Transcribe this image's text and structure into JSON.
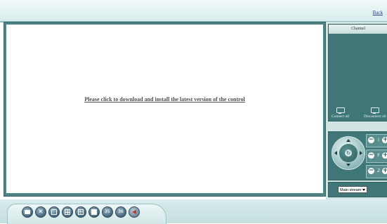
{
  "header": {
    "back_label": "Back"
  },
  "main": {
    "install_message": "Please click to download and install the latest version of the control"
  },
  "channel_panel": {
    "title": "Channel",
    "connect_all_label": "Connect all",
    "disconnect_all_label": "Disconnect all"
  },
  "ptz": {
    "center_icon": "refresh-icon",
    "rows": [
      {
        "label": "I"
      },
      {
        "label": "F"
      },
      {
        "label": "Z"
      }
    ],
    "minus_glyph": "−",
    "plus_glyph": "+"
  },
  "stream": {
    "selected": "Main stream"
  },
  "toolbar": {
    "buttons": [
      {
        "icon": "snapshot-icon",
        "text": ""
      },
      {
        "icon": "tools-icon",
        "text": ""
      },
      {
        "icon": "single-view-icon",
        "text": ""
      },
      {
        "icon": "quad-view-icon",
        "text": ""
      },
      {
        "icon": "nine-view-icon",
        "text": ""
      },
      {
        "icon": "sixteen-view-icon",
        "text": ""
      },
      {
        "icon": "view-25-icon",
        "text": "25"
      },
      {
        "icon": "view-36-icon",
        "text": "36"
      },
      {
        "icon": "speaker-icon",
        "text": ""
      }
    ]
  },
  "colors": {
    "panel_teal": "#3f7677",
    "frame_teal": "#4f8384",
    "link_blue": "#2b3b9a",
    "background_light": "#d0e4e4"
  }
}
